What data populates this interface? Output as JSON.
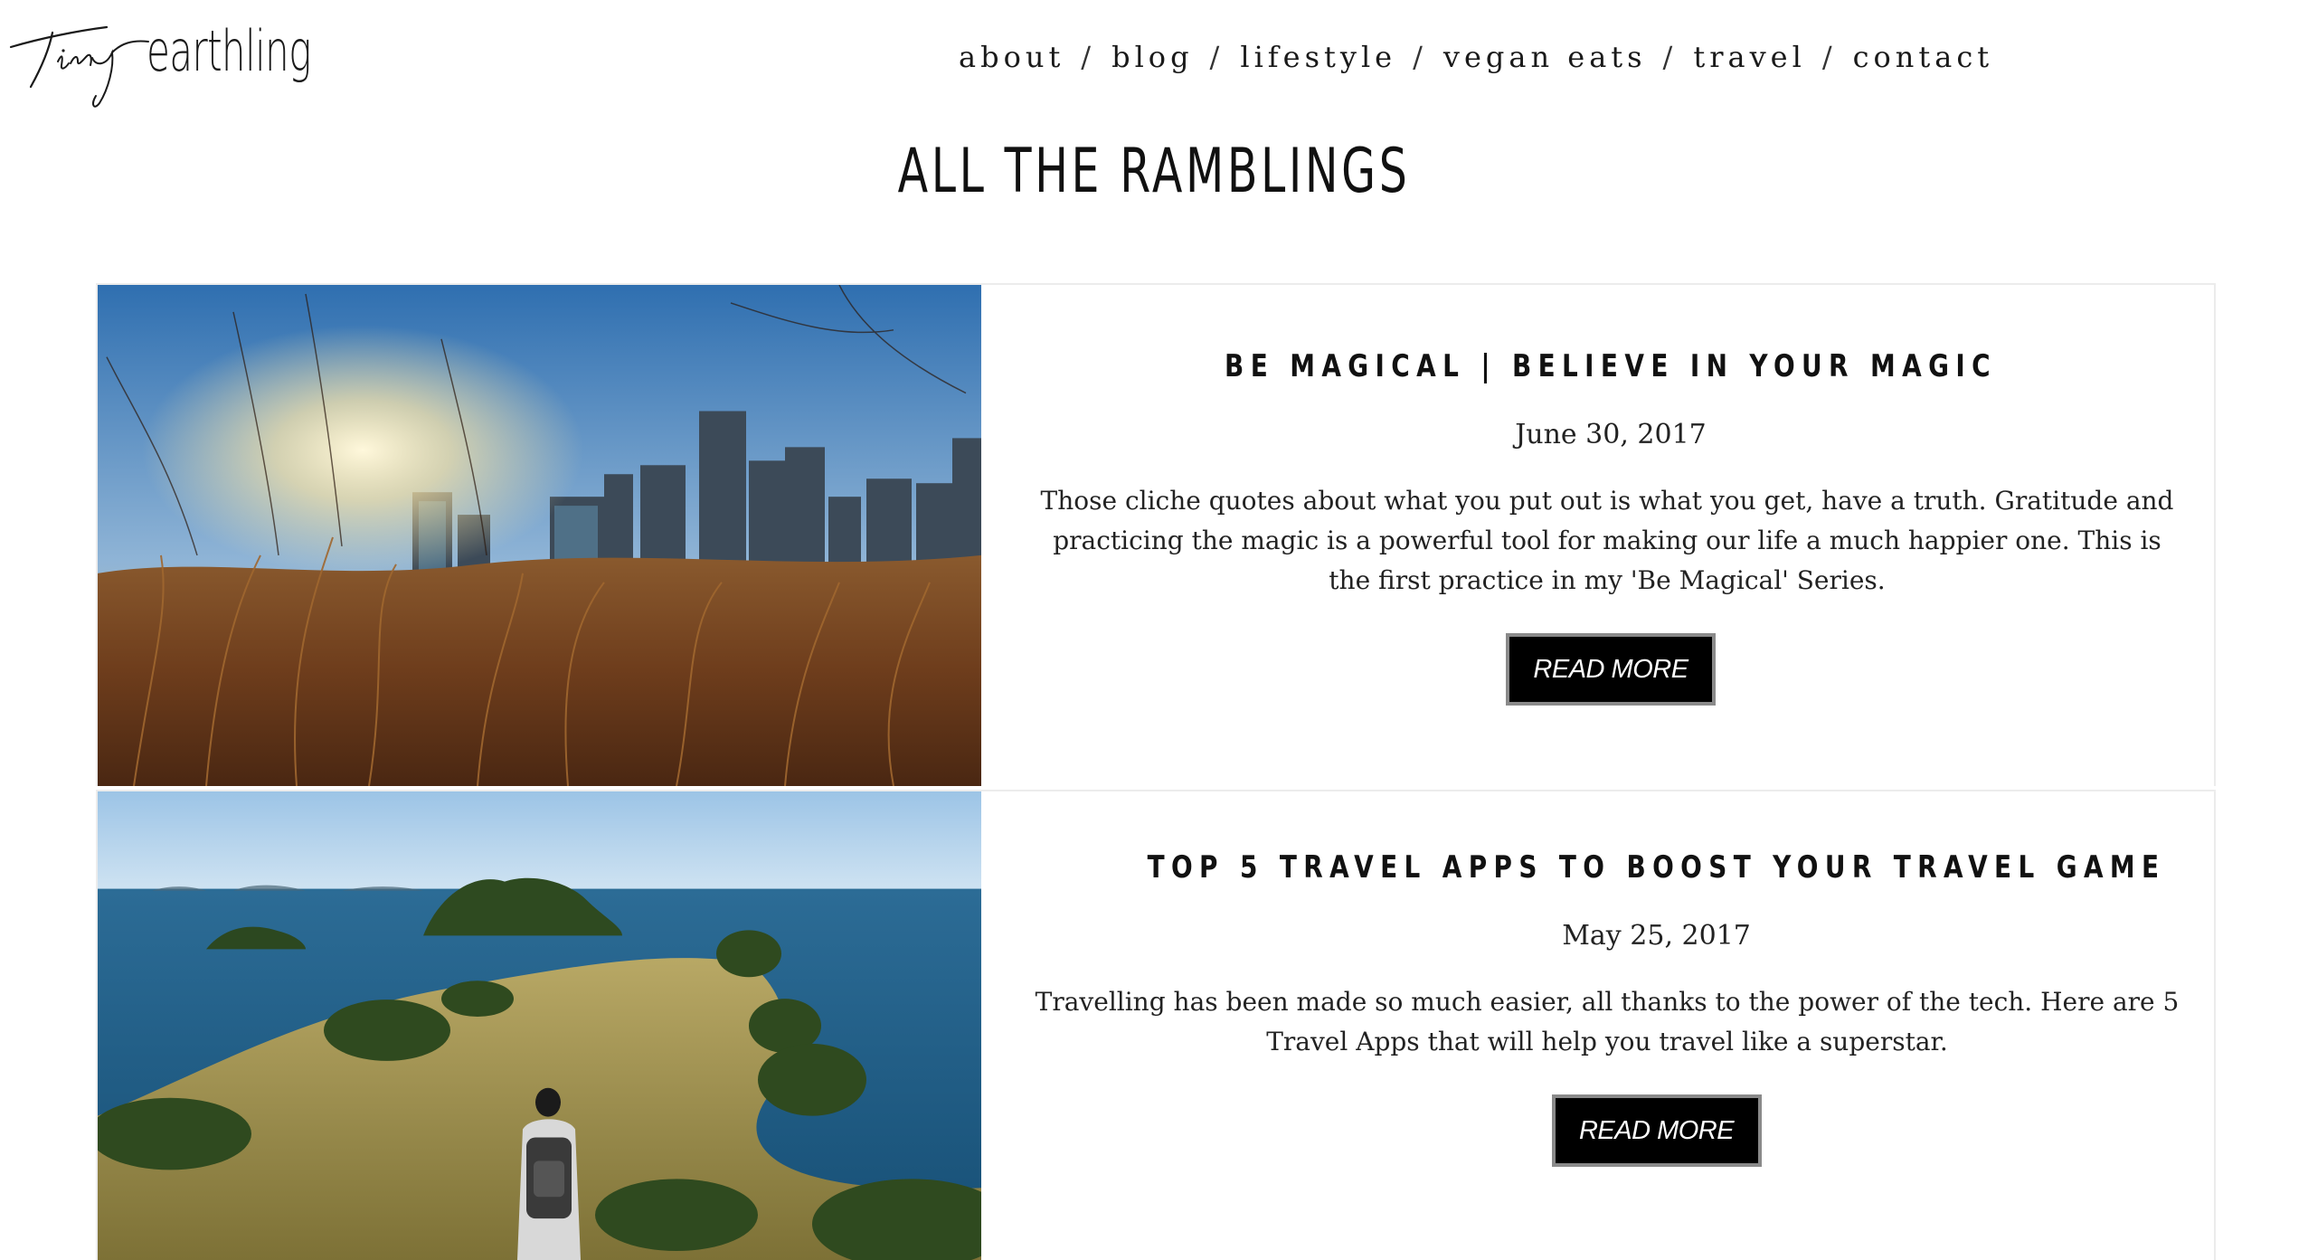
{
  "header": {
    "logo_script": "Tiny",
    "logo_text": "earthling",
    "nav": [
      {
        "label": "about"
      },
      {
        "label": "blog"
      },
      {
        "label": "lifestyle"
      },
      {
        "label": "vegan eats"
      },
      {
        "label": "travel"
      },
      {
        "label": "contact"
      }
    ],
    "nav_separator": "/"
  },
  "page": {
    "title": "ALL THE RAMBLINGS"
  },
  "posts": [
    {
      "title": "BE MAGICAL | BELIEVE IN YOUR MAGIC",
      "date": "June 30, 2017",
      "excerpt": "Those cliche quotes about what you put out is what you get, have a truth. Gratitude and practicing the magic is a powerful tool for making our life a much happier one. This is the first practice in my 'Be Magical' Series.",
      "button": "READ MORE",
      "image": "city-skyline-through-grass"
    },
    {
      "title": "TOP 5 TRAVEL APPS TO BOOST YOUR TRAVEL GAME",
      "date": "May 25, 2017",
      "excerpt": "Travelling has been made so much easier, all thanks to the power of the tech. Here are 5 Travel Apps that will help you travel like a superstar.",
      "button": "READ MORE",
      "image": "coastal-hike-islands"
    }
  ],
  "colors": {
    "background": "#ffffff",
    "text": "#111111",
    "button_bg": "#000000",
    "button_text": "#ffffff",
    "button_border": "#8a8a8a"
  }
}
